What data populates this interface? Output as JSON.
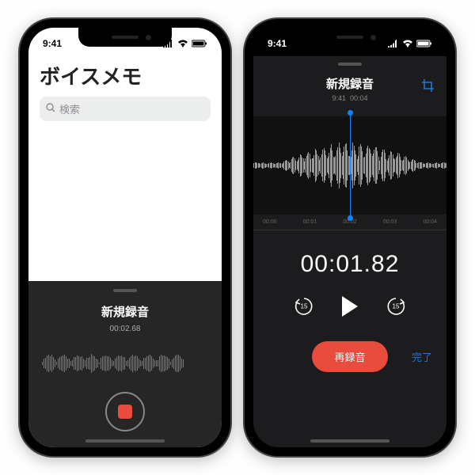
{
  "status": {
    "time": "9:41"
  },
  "left": {
    "app_title": "ボイスメモ",
    "search_placeholder": "検索",
    "recording_title": "新規録音",
    "recording_time": "00:02.68"
  },
  "right": {
    "title": "新規録音",
    "subtitle_time": "9:41",
    "subtitle_duration": "00:04",
    "ruler": [
      "00:00",
      "00:01",
      "00:02",
      "00:03",
      "00:04"
    ],
    "bigtime": "00:01.82",
    "skip_amount": "15",
    "rerecord_label": "再録音",
    "done_label": "完了"
  },
  "colors": {
    "accent_red": "#e94b3c",
    "accent_blue": "#0a84ff",
    "link_blue": "#1e76d6"
  }
}
